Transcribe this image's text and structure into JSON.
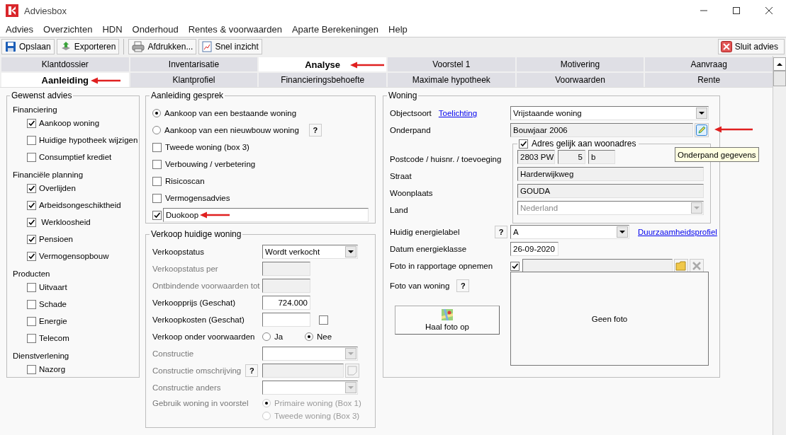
{
  "window": {
    "title": "Adviesbox"
  },
  "menu": [
    "Advies",
    "Overzichten",
    "HDN",
    "Onderhoud",
    "Rentes & voorwaarden",
    "Aparte Berekeningen",
    "Help"
  ],
  "toolbar": [
    {
      "label": "Opslaan",
      "kind": "save"
    },
    {
      "label": "Exporteren",
      "kind": "export"
    },
    {
      "label": "Afdrukken...",
      "kind": "print"
    },
    {
      "label": "Snel inzicht",
      "kind": "report"
    }
  ],
  "close_button": {
    "label": "Sluit advies"
  },
  "tabs": [
    {
      "label": "Klantdossier",
      "selected": false
    },
    {
      "label": "Inventarisatie",
      "selected": false
    },
    {
      "label": "Analyse",
      "selected": true
    },
    {
      "label": "Voorstel 1",
      "selected": false
    },
    {
      "label": "Motivering",
      "selected": false
    },
    {
      "label": "Aanvraag",
      "selected": false
    }
  ],
  "subtabs": [
    {
      "label": "Aanleiding",
      "selected": true
    },
    {
      "label": "Klantprofiel",
      "selected": false
    },
    {
      "label": "Financieringsbehoefte",
      "selected": false
    },
    {
      "label": "Maximale hypotheek",
      "selected": false
    },
    {
      "label": "Voorwaarden",
      "selected": false
    },
    {
      "label": "Rente",
      "selected": false
    }
  ],
  "gewenst_advies": {
    "title": "Gewenst advies",
    "groups": [
      {
        "title": "Financiering",
        "items": [
          {
            "label": "Aankoop woning",
            "checked": true
          },
          {
            "label": "Huidige hypotheek wijzigen",
            "checked": false
          },
          {
            "label": "Consumptief krediet",
            "checked": false
          }
        ]
      },
      {
        "title": "Financiële planning",
        "items": [
          {
            "label": "Overlijden",
            "checked": true
          },
          {
            "label": "Arbeidsongeschiktheid",
            "checked": true
          },
          {
            "label": " Werkloosheid",
            "checked": true
          },
          {
            "label": "Pensioen",
            "checked": true
          },
          {
            "label": "Vermogensopbouw",
            "checked": true
          }
        ]
      },
      {
        "title": "Producten",
        "items": [
          {
            "label": "Uitvaart",
            "checked": false
          },
          {
            "label": "Schade",
            "checked": false
          },
          {
            "label": "Energie",
            "checked": false
          },
          {
            "label": "Telecom",
            "checked": false
          }
        ]
      },
      {
        "title": "Dienstverlening",
        "items": [
          {
            "label": "Nazorg",
            "checked": false
          }
        ]
      }
    ]
  },
  "aanleiding_gesprek": {
    "title": "Aanleiding gesprek",
    "items": [
      {
        "kind": "radio",
        "label": "Aankoop van een bestaande woning",
        "selected": true
      },
      {
        "kind": "radio",
        "label": "Aankoop van een nieuwbouw woning",
        "selected": false,
        "help": "?"
      },
      {
        "kind": "checkbox",
        "label": "Tweede woning (box 3)",
        "checked": false
      },
      {
        "kind": "checkbox",
        "label": "Verbouwing / verbetering",
        "checked": false
      },
      {
        "kind": "checkbox",
        "label": "Risicoscan",
        "checked": false
      },
      {
        "kind": "checkbox",
        "label": "Vermogensadvies",
        "checked": false
      },
      {
        "kind": "text",
        "value": "Duokoop",
        "checked": true
      }
    ]
  },
  "verkoop": {
    "title": "Verkoop huidige woning",
    "rows": [
      {
        "kind": "select",
        "label": "Verkoopstatus",
        "value": "Wordt verkocht",
        "disabled": false
      },
      {
        "kind": "input",
        "label": "Verkoopstatus per",
        "disabled": true
      },
      {
        "kind": "input",
        "label": "Ontbindende voorwaarden tot",
        "disabled": true
      },
      {
        "kind": "input",
        "label": "Verkoopprijs (Geschat)",
        "value": "724.000",
        "disabled": false
      },
      {
        "kind": "input_check",
        "label": "Verkoopkosten (Geschat)",
        "checked": false,
        "disabled": false
      },
      {
        "kind": "radios",
        "label": "Verkoop onder voorwaarden",
        "disabled": false,
        "options": [
          {
            "label": "Ja",
            "selected": false
          },
          {
            "label": "Nee",
            "selected": true
          }
        ]
      },
      {
        "kind": "select",
        "label": "Constructie",
        "disabled": true
      },
      {
        "kind": "edit",
        "label": "Constructie omschrijving",
        "help": "?",
        "disabled": true
      },
      {
        "kind": "select",
        "label": "Constructie anders",
        "disabled": true
      },
      {
        "kind": "radiolist",
        "label": "Gebruik woning in voorstel",
        "disabled": true,
        "options": [
          {
            "label": "Primaire woning (Box 1)",
            "selected": true
          },
          {
            "label": "Tweede woning (Box 3)",
            "selected": false
          }
        ]
      }
    ]
  },
  "woning": {
    "title": "Woning",
    "objectsoort": {
      "label": "Objectsoort",
      "link": "Toelichting",
      "value": "Vrijstaande woning"
    },
    "onderpand": {
      "label": "Onderpand",
      "value": "Bouwjaar 2006"
    },
    "adres": {
      "title": "Adres gelijk aan woonadres",
      "checked": true,
      "postcode_label": "Postcode / huisnr. / toevoeging",
      "postcode": "2803 PW",
      "huisnr": "5",
      "toevoeging": "b",
      "straat_label": "Straat",
      "straat": "Harderwijkweg",
      "woonplaats_label": "Woonplaats",
      "woonplaats": "GOUDA",
      "land_label": "Land",
      "land": "Nederland"
    },
    "energielabel": {
      "label": "Huidig energielabel",
      "help": "?",
      "value": "A",
      "link": "Duurzaamheidsprofiel"
    },
    "datum": {
      "label": "Datum energieklasse",
      "value": "26-09-2020"
    },
    "foto_rapportage": {
      "label": "Foto in rapportage opnemen",
      "checked": true
    },
    "foto": {
      "label": "Foto van woning",
      "help": "?",
      "button": "Haal foto op",
      "empty_text": "Geen foto"
    }
  },
  "tooltip": "Onderpand gegevens"
}
